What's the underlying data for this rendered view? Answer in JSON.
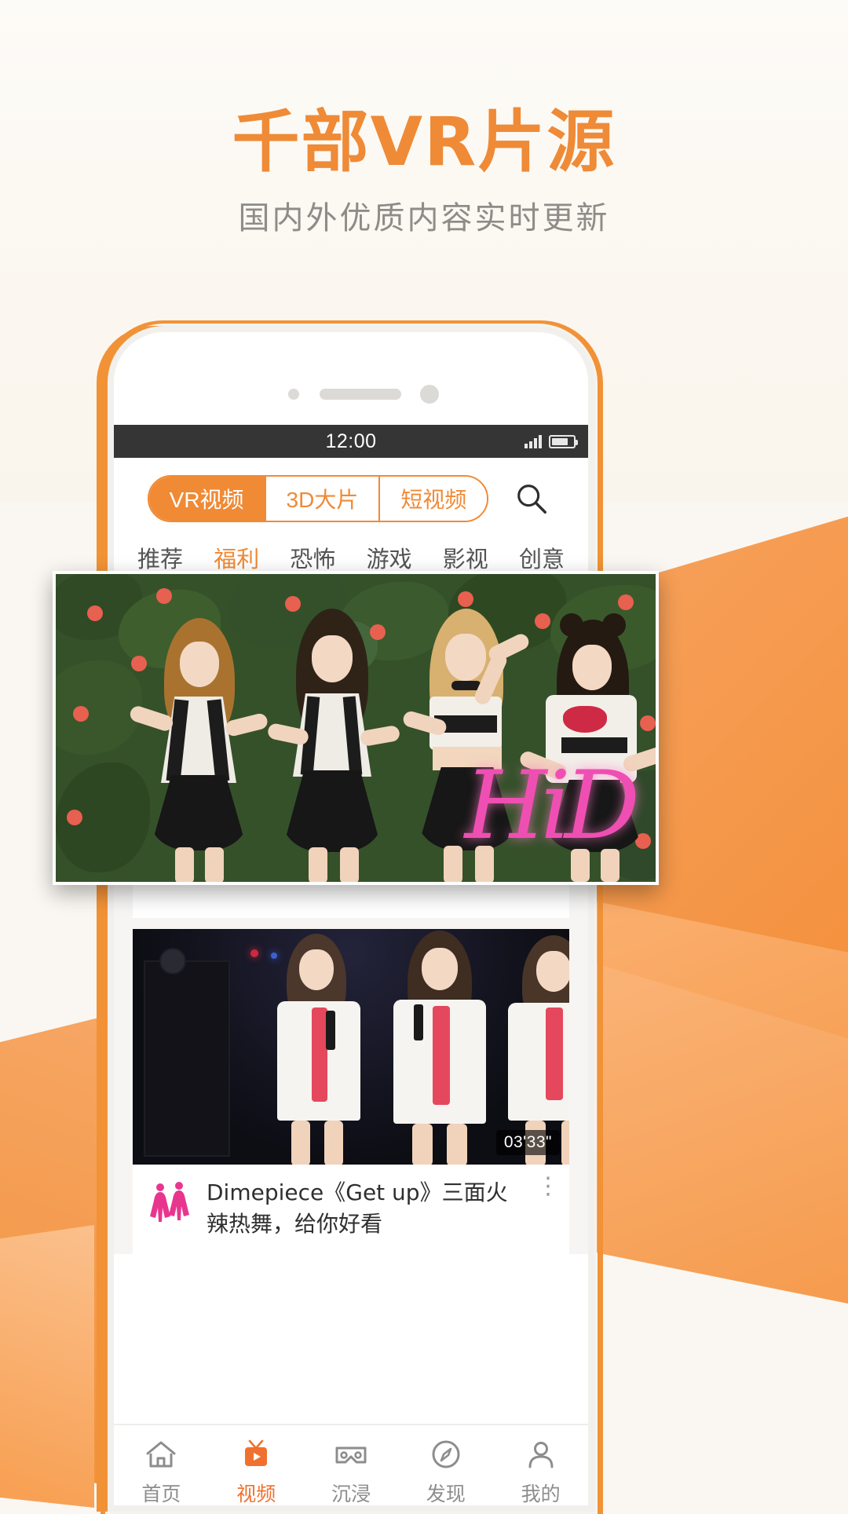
{
  "promo": {
    "title": "千部VR片源",
    "subtitle": "国内外优质内容实时更新",
    "accent_color": "#ef8a37",
    "subtitle_color": "#8e8c89"
  },
  "phone": {
    "statusbar": {
      "time": "12:00",
      "signal_icon": "cellular-signal-icon",
      "battery_icon": "battery-icon"
    },
    "app": {
      "segmented_control": {
        "selected": "VR视频",
        "items": [
          {
            "label": "VR视频",
            "active": true
          },
          {
            "label": "3D大片",
            "active": false
          },
          {
            "label": "短视频",
            "active": false
          }
        ]
      },
      "search_icon": "search-icon",
      "categories": [
        {
          "label": "推荐",
          "active": false
        },
        {
          "label": "福利",
          "active": true
        },
        {
          "label": "恐怖",
          "active": false
        },
        {
          "label": "游戏",
          "active": false
        },
        {
          "label": "影视",
          "active": false
        },
        {
          "label": "创意",
          "active": false
        }
      ],
      "feed": [
        {
          "thumb_alt": "four-girls-group-photo-flower-wall",
          "watermark": "HiD",
          "duration": "",
          "title": "",
          "avatar_icon": "dancers-avatar-icon",
          "more_icon": "more-vertical-icon"
        },
        {
          "thumb_alt": "girl-group-stage-performance",
          "duration": "03'33\"",
          "title": "Dimepiece《Get up》三面火辣热舞，给你好看",
          "avatar_icon": "dancers-avatar-icon",
          "more_icon": "more-vertical-icon"
        }
      ],
      "bottom_nav": [
        {
          "label": "首页",
          "icon": "home-icon",
          "active": false
        },
        {
          "label": "视频",
          "icon": "video-tv-play-icon",
          "active": true
        },
        {
          "label": "沉浸",
          "icon": "vr-goggles-icon",
          "active": false
        },
        {
          "label": "发现",
          "icon": "compass-icon",
          "active": false
        },
        {
          "label": "我的",
          "icon": "user-person-icon",
          "active": false
        }
      ],
      "active_nav_color": "#f0712f"
    }
  }
}
